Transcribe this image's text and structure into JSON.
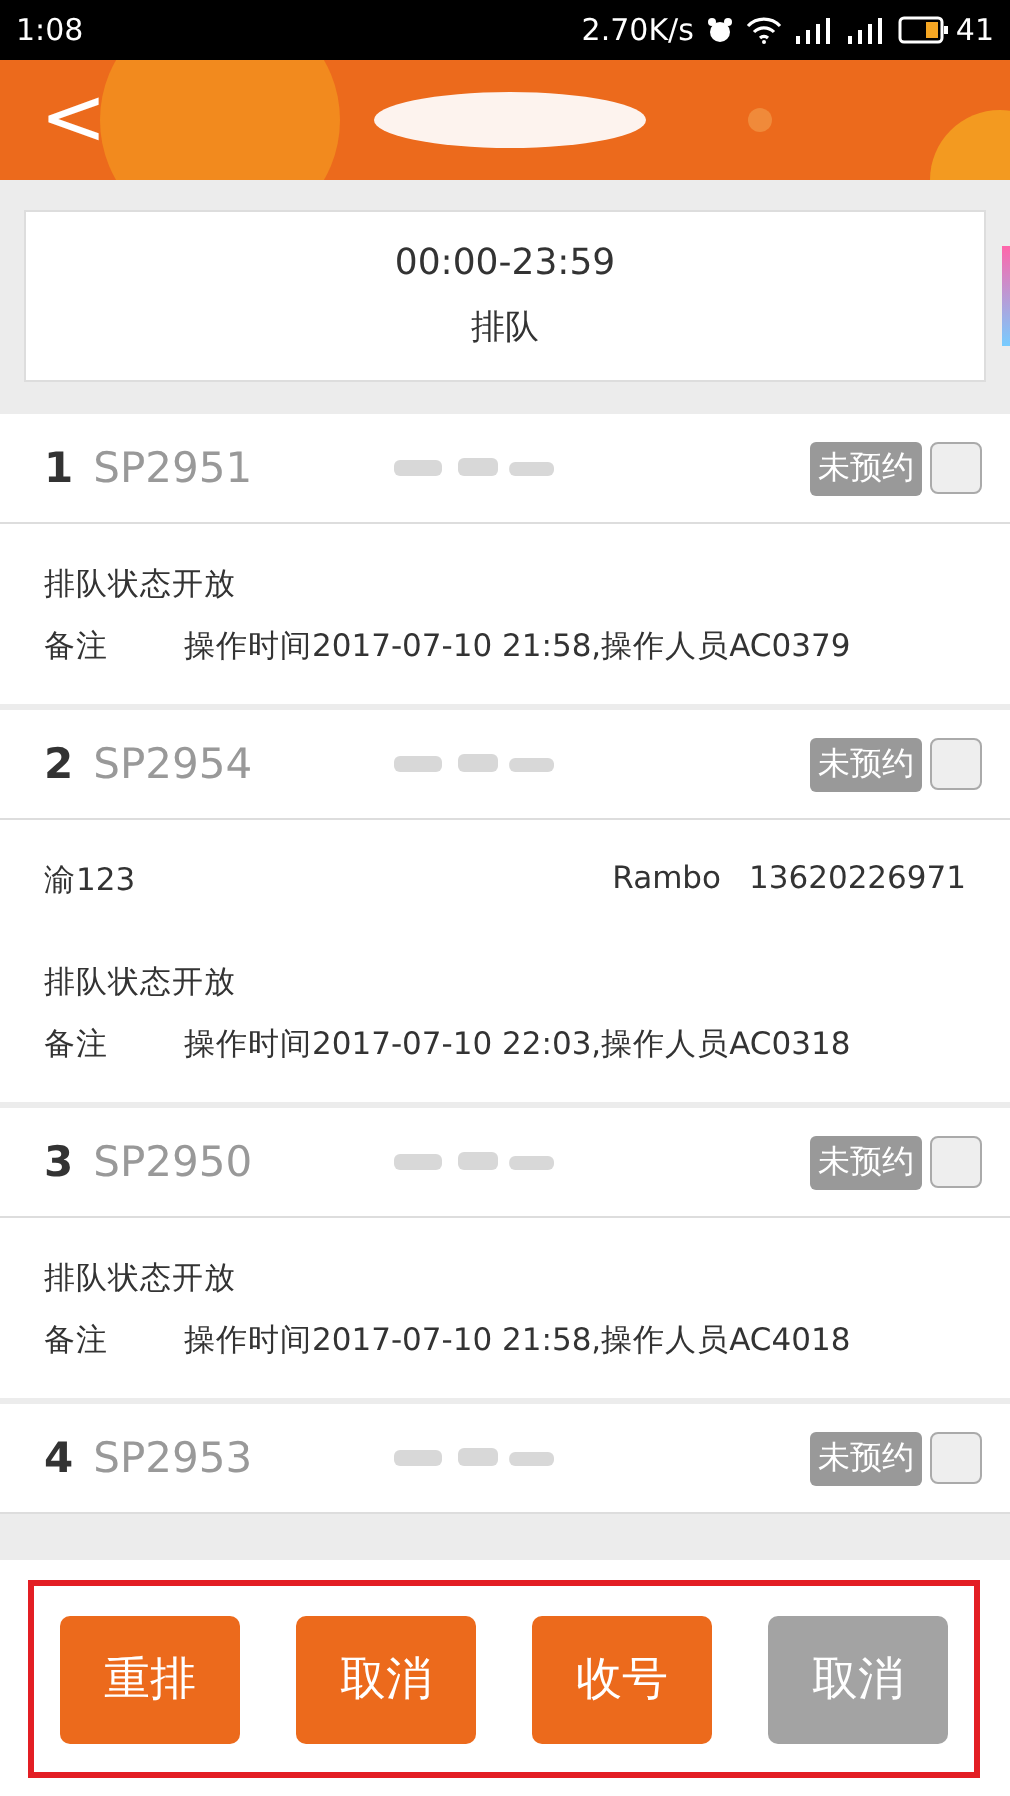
{
  "status_bar": {
    "time": "1:08",
    "speed": "2.70K/s",
    "battery": "41"
  },
  "header": {
    "back": "<"
  },
  "time_card": {
    "range": "00:00-23:59",
    "label": "排队"
  },
  "items": [
    {
      "index": "1",
      "code": "SP2951",
      "badge": "未预约",
      "checked": false,
      "queue_status": "排队状态开放",
      "remark_label": "备注",
      "remark": "操作时间2017-07-10 21:58,操作人员AC0379"
    },
    {
      "index": "2",
      "code": "SP2954",
      "badge": "未预约",
      "checked": false,
      "plate": "渝123",
      "driver": "Rambo",
      "phone": "13620226971",
      "queue_status": "排队状态开放",
      "remark_label": "备注",
      "remark": "操作时间2017-07-10 22:03,操作人员AC0318"
    },
    {
      "index": "3",
      "code": "SP2950",
      "badge": "未预约",
      "checked": false,
      "queue_status": "排队状态开放",
      "remark_label": "备注",
      "remark": "操作时间2017-07-10 21:58,操作人员AC4018"
    },
    {
      "index": "4",
      "code": "SP2953",
      "badge": "未预约",
      "checked": false
    }
  ],
  "buttons": [
    {
      "label": "重排",
      "disabled": false
    },
    {
      "label": "取消",
      "disabled": false
    },
    {
      "label": "收号",
      "disabled": false
    },
    {
      "label": "取消",
      "disabled": true
    }
  ]
}
